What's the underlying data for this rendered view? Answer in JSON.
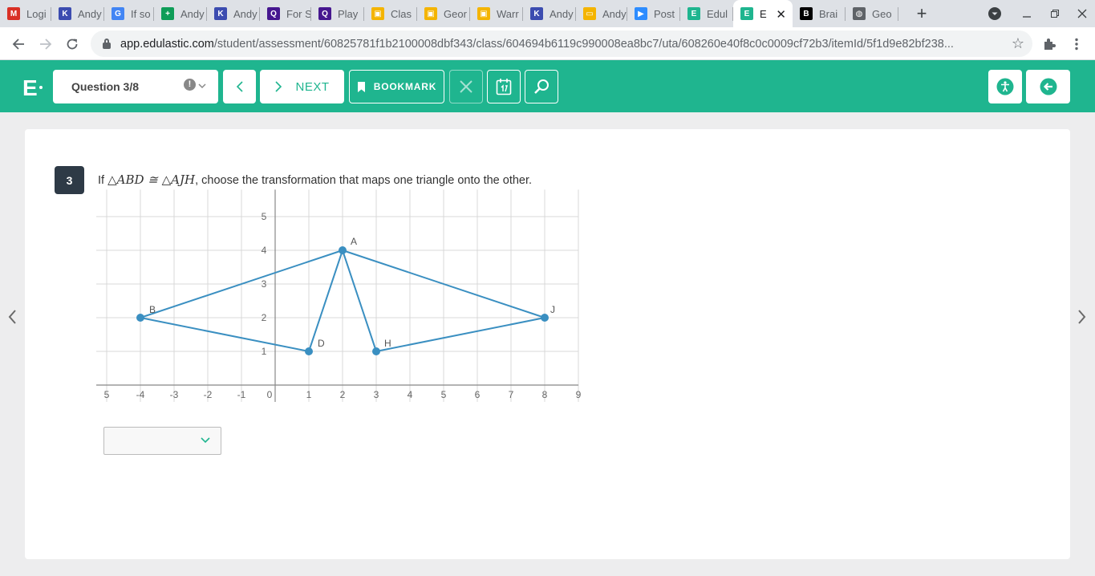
{
  "browser": {
    "tabs": [
      {
        "label": "Logi",
        "fav": "M",
        "color": "#d93025"
      },
      {
        "label": "Andy",
        "fav": "K",
        "color": "#3c4cb0"
      },
      {
        "label": "If so",
        "fav": "G",
        "color": "#4285f4"
      },
      {
        "label": "Andy",
        "fav": "+",
        "color": "#0f9d58"
      },
      {
        "label": "Andy",
        "fav": "K",
        "color": "#3c4cb0"
      },
      {
        "label": "For S",
        "fav": "Q",
        "color": "#46178f"
      },
      {
        "label": "Play",
        "fav": "Q",
        "color": "#46178f"
      },
      {
        "label": "Clas",
        "fav": "▣",
        "color": "#f4b400"
      },
      {
        "label": "Geor",
        "fav": "▣",
        "color": "#f4b400"
      },
      {
        "label": "Warr",
        "fav": "▣",
        "color": "#f4b400"
      },
      {
        "label": "Andy",
        "fav": "K",
        "color": "#3c4cb0"
      },
      {
        "label": "Andy",
        "fav": "▭",
        "color": "#f4b400"
      },
      {
        "label": "Post",
        "fav": "▶",
        "color": "#2d8cff"
      },
      {
        "label": "Edul",
        "fav": "E",
        "color": "#1fb58f"
      },
      {
        "label": "E",
        "fav": "E",
        "color": "#1fb58f",
        "active": true
      },
      {
        "label": "Brai",
        "fav": "B",
        "color": "#000000"
      },
      {
        "label": "Geo",
        "fav": "◍",
        "color": "#5f6368"
      }
    ],
    "url_host": "app.edulastic.com",
    "url_path": "/student/assessment/60825781f1b2100008dbf343/class/604694b6119c990008ea8bc7/uta/608260e40f8c0c0009cf72b3/itemId/5f1d9e82bf238..."
  },
  "header": {
    "question_selector": "Question 3/8",
    "next_label": "NEXT",
    "bookmark_label": "BOOKMARK"
  },
  "question": {
    "number": "3",
    "stem_prefix": "If",
    "stem_math": "△ABD ≅ △AJH",
    "stem_suffix": ", choose the transformation that maps one triangle onto the other.",
    "answer_value": ""
  },
  "graph": {
    "x_ticks": [
      "5",
      "-4",
      "-3",
      "-2",
      "-1",
      "0",
      "1",
      "2",
      "3",
      "4",
      "5",
      "6",
      "7",
      "8",
      "9"
    ],
    "y_ticks": [
      "1",
      "2",
      "3",
      "4",
      "5"
    ],
    "points": [
      {
        "label": "A",
        "x": 2,
        "y": 4
      },
      {
        "label": "B",
        "x": -4,
        "y": 2
      },
      {
        "label": "D",
        "x": 1,
        "y": 1
      },
      {
        "label": "J",
        "x": 8,
        "y": 2
      },
      {
        "label": "H",
        "x": 3,
        "y": 1
      }
    ],
    "triangles": [
      [
        "A",
        "B",
        "D"
      ],
      [
        "A",
        "J",
        "H"
      ]
    ],
    "line_color": "#3a8fc1"
  }
}
